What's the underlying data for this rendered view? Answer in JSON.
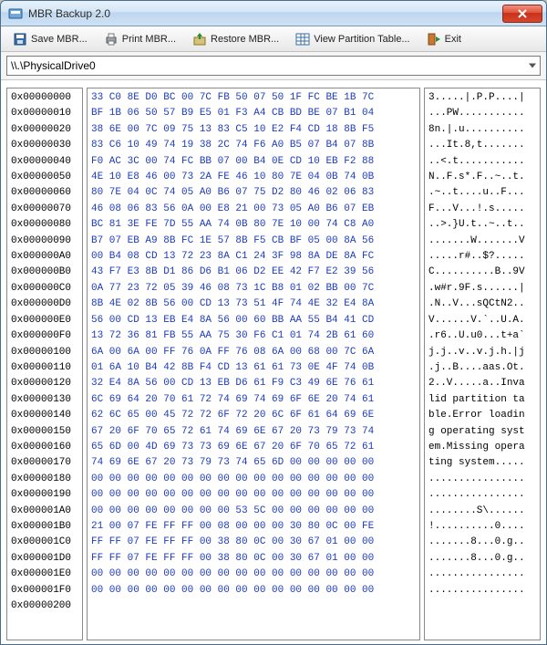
{
  "window": {
    "title": "MBR Backup 2.0"
  },
  "toolbar": {
    "save": "Save MBR...",
    "print": "Print MBR...",
    "restore": "Restore MBR...",
    "view": "View Partition Table...",
    "exit": "Exit"
  },
  "drive": {
    "selected": "\\\\.\\PhysicalDrive0"
  },
  "chart_data": {
    "type": "table",
    "title": "MBR hex dump",
    "columns": [
      "offset",
      "bytes",
      "ascii"
    ],
    "rows": [
      {
        "offset": "0x00000000",
        "bytes": "33 C0 8E D0 BC 00 7C FB 50 07 50 1F FC BE 1B 7C",
        "ascii": "3.....|.P.P....|"
      },
      {
        "offset": "0x00000010",
        "bytes": "BF 1B 06 50 57 B9 E5 01 F3 A4 CB BD BE 07 B1 04",
        "ascii": "...PW..........."
      },
      {
        "offset": "0x00000020",
        "bytes": "38 6E 00 7C 09 75 13 83 C5 10 E2 F4 CD 18 8B F5",
        "ascii": "8n.|.u.........."
      },
      {
        "offset": "0x00000030",
        "bytes": "83 C6 10 49 74 19 38 2C 74 F6 A0 B5 07 B4 07 8B",
        "ascii": "...It.8,t......."
      },
      {
        "offset": "0x00000040",
        "bytes": "F0 AC 3C 00 74 FC BB 07 00 B4 0E CD 10 EB F2 88",
        "ascii": "..<.t..........."
      },
      {
        "offset": "0x00000050",
        "bytes": "4E 10 E8 46 00 73 2A FE 46 10 80 7E 04 0B 74 0B",
        "ascii": "N..F.s*.F..~..t."
      },
      {
        "offset": "0x00000060",
        "bytes": "80 7E 04 0C 74 05 A0 B6 07 75 D2 80 46 02 06 83",
        "ascii": ".~..t....u..F..."
      },
      {
        "offset": "0x00000070",
        "bytes": "46 08 06 83 56 0A 00 E8 21 00 73 05 A0 B6 07 EB",
        "ascii": "F...V...!.s....."
      },
      {
        "offset": "0x00000080",
        "bytes": "BC 81 3E FE 7D 55 AA 74 0B 80 7E 10 00 74 C8 A0",
        "ascii": "..>.}U.t..~..t.."
      },
      {
        "offset": "0x00000090",
        "bytes": "B7 07 EB A9 8B FC 1E 57 8B F5 CB BF 05 00 8A 56",
        "ascii": ".......W.......V"
      },
      {
        "offset": "0x000000A0",
        "bytes": "00 B4 08 CD 13 72 23 8A C1 24 3F 98 8A DE 8A FC",
        "ascii": ".....r#..$?....."
      },
      {
        "offset": "0x000000B0",
        "bytes": "43 F7 E3 8B D1 86 D6 B1 06 D2 EE 42 F7 E2 39 56",
        "ascii": "C..........B..9V"
      },
      {
        "offset": "0x000000C0",
        "bytes": "0A 77 23 72 05 39 46 08 73 1C B8 01 02 BB 00 7C",
        "ascii": ".w#r.9F.s......|"
      },
      {
        "offset": "0x000000D0",
        "bytes": "8B 4E 02 8B 56 00 CD 13 73 51 4F 74 4E 32 E4 8A",
        "ascii": ".N..V...sQCtN2.."
      },
      {
        "offset": "0x000000E0",
        "bytes": "56 00 CD 13 EB E4 8A 56 00 60 BB AA 55 B4 41 CD",
        "ascii": "V......V.`..U.A."
      },
      {
        "offset": "0x000000F0",
        "bytes": "13 72 36 81 FB 55 AA 75 30 F6 C1 01 74 2B 61 60",
        "ascii": ".r6..U.u0...t+a`"
      },
      {
        "offset": "0x00000100",
        "bytes": "6A 00 6A 00 FF 76 0A FF 76 08 6A 00 68 00 7C 6A",
        "ascii": "j.j..v..v.j.h.|j"
      },
      {
        "offset": "0x00000110",
        "bytes": "01 6A 10 B4 42 8B F4 CD 13 61 61 73 0E 4F 74 0B",
        "ascii": ".j..B....aas.Ot."
      },
      {
        "offset": "0x00000120",
        "bytes": "32 E4 8A 56 00 CD 13 EB D6 61 F9 C3 49 6E 76 61",
        "ascii": "2..V.....a..Inva"
      },
      {
        "offset": "0x00000130",
        "bytes": "6C 69 64 20 70 61 72 74 69 74 69 6F 6E 20 74 61",
        "ascii": "lid partition ta"
      },
      {
        "offset": "0x00000140",
        "bytes": "62 6C 65 00 45 72 72 6F 72 20 6C 6F 61 64 69 6E",
        "ascii": "ble.Error loadin"
      },
      {
        "offset": "0x00000150",
        "bytes": "67 20 6F 70 65 72 61 74 69 6E 67 20 73 79 73 74",
        "ascii": "g operating syst"
      },
      {
        "offset": "0x00000160",
        "bytes": "65 6D 00 4D 69 73 73 69 6E 67 20 6F 70 65 72 61",
        "ascii": "em.Missing opera"
      },
      {
        "offset": "0x00000170",
        "bytes": "74 69 6E 67 20 73 79 73 74 65 6D 00 00 00 00 00",
        "ascii": "ting system....."
      },
      {
        "offset": "0x00000180",
        "bytes": "00 00 00 00 00 00 00 00 00 00 00 00 00 00 00 00",
        "ascii": "................"
      },
      {
        "offset": "0x00000190",
        "bytes": "00 00 00 00 00 00 00 00 00 00 00 00 00 00 00 00",
        "ascii": "................"
      },
      {
        "offset": "0x000001A0",
        "bytes": "00 00 00 00 00 00 00 00 53 5C 00 00 00 00 00 00",
        "ascii": "........S\\......"
      },
      {
        "offset": "0x000001B0",
        "bytes": "21 00 07 FE FF FF 00 08 00 00 00 30 80 0C 00 FE",
        "ascii": "!..........0...."
      },
      {
        "offset": "0x000001C0",
        "bytes": "FF FF 07 FE FF FF 00 38 80 0C 00 30 67 01 00 00",
        "ascii": ".......8...0.g.."
      },
      {
        "offset": "0x000001D0",
        "bytes": "FF FF 07 FE FF FF 00 38 80 0C 00 30 67 01 00 00",
        "ascii": ".......8...0.g.."
      },
      {
        "offset": "0x000001E0",
        "bytes": "00 00 00 00 00 00 00 00 00 00 00 00 00 00 00 00",
        "ascii": "................"
      },
      {
        "offset": "0x000001F0",
        "bytes": "00 00 00 00 00 00 00 00 00 00 00 00 00 00 00 00",
        "ascii": "................"
      },
      {
        "offset": "0x00000200",
        "bytes": "",
        "ascii": ""
      }
    ]
  }
}
